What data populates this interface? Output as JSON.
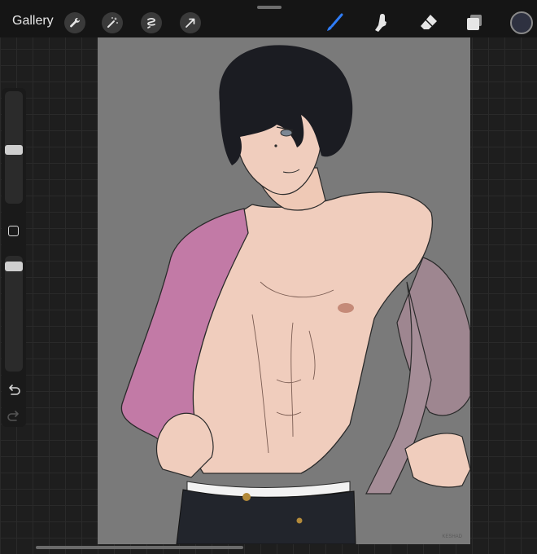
{
  "topbar": {
    "gallery_label": "Gallery",
    "left_tools": [
      "wrench-icon",
      "magic-wand-icon",
      "selection-icon",
      "transform-arrow-icon"
    ],
    "right_tools": [
      "brush-icon",
      "smudge-icon",
      "eraser-icon",
      "layers-icon"
    ],
    "active_tool": "brush-icon",
    "accent_color": "#2f7cf6",
    "current_color": "#2e3140"
  },
  "sidebar": {
    "brush_size_level": 0.55,
    "opacity_level": 0.05
  },
  "canvas": {
    "background_color": "#7a7a7a",
    "watermark": "KESHAD"
  }
}
